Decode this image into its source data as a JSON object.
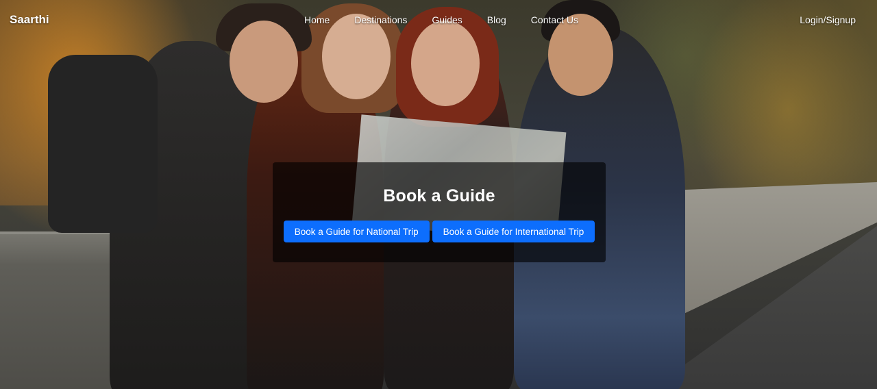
{
  "navbar": {
    "brand": "Saarthi",
    "links": [
      "Home",
      "Destinations",
      "Guides",
      "Blog",
      "Contact Us"
    ],
    "login": "Login/Signup"
  },
  "hero": {
    "title": "Book a Guide",
    "buttons": {
      "national": "Book a Guide for National Trip",
      "international": "Book a Guide for International Trip"
    },
    "button_color": "#0d6efd",
    "panel_color": "rgba(0,0,0,0.62)"
  }
}
